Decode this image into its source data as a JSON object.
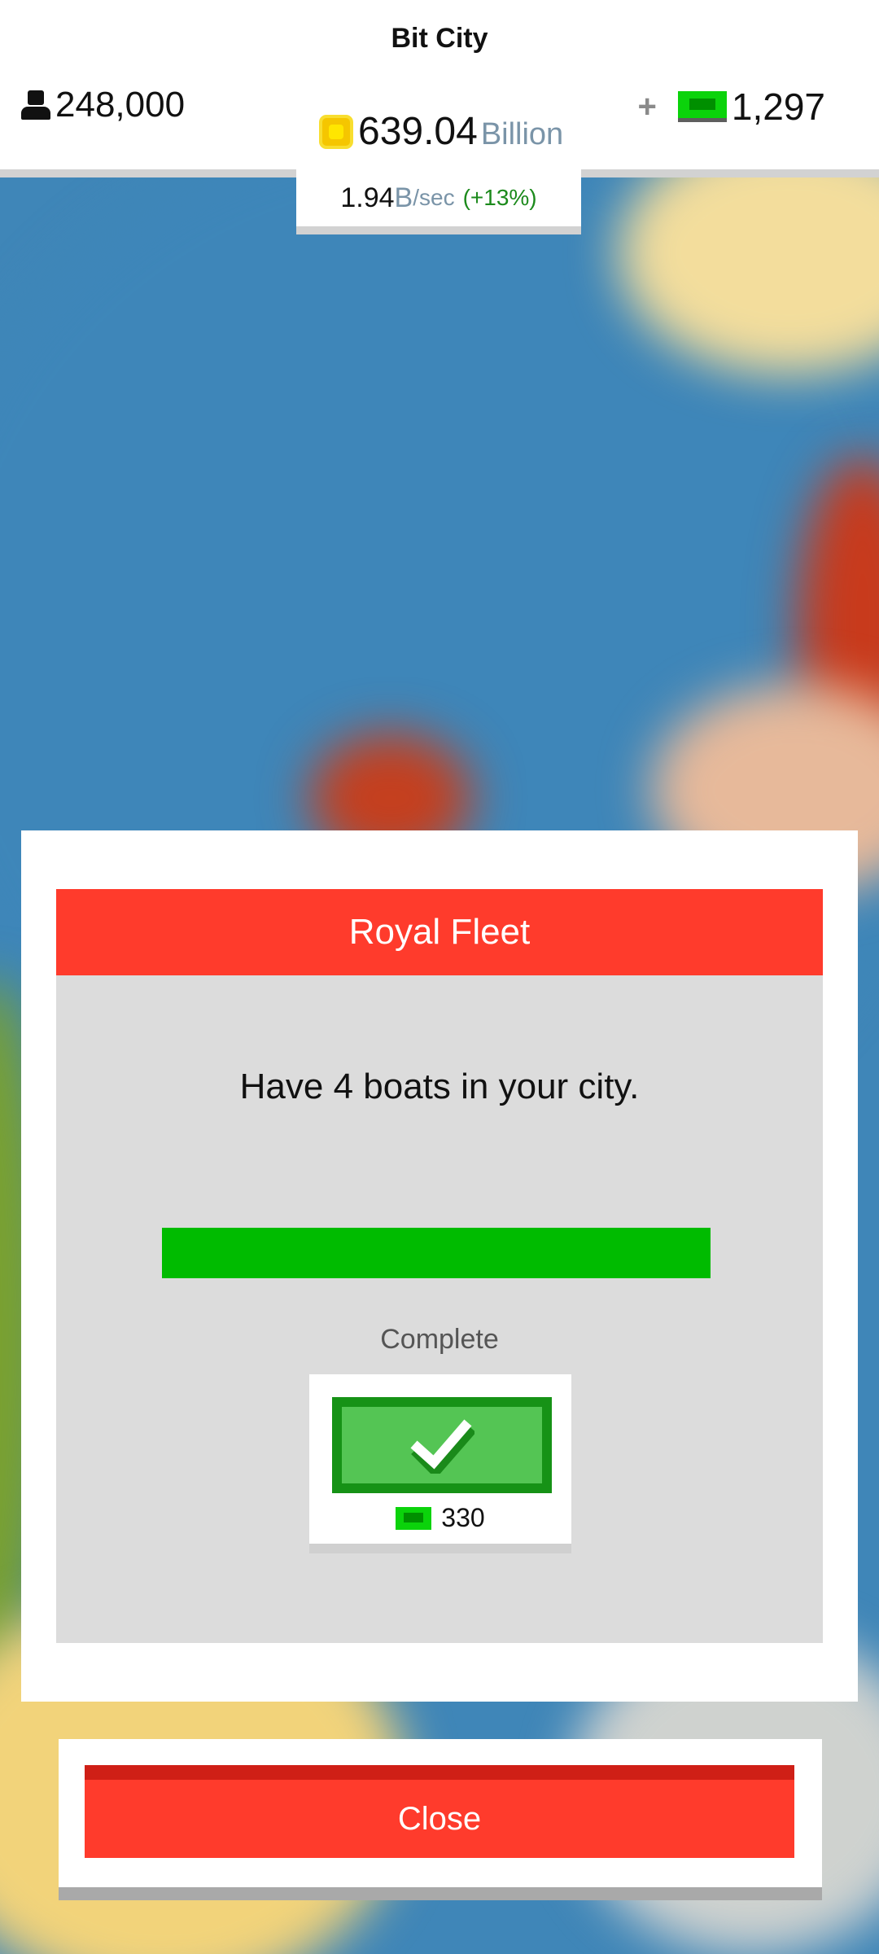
{
  "header": {
    "city_name": "Bit City",
    "population": "248,000",
    "coins_value": "639.04",
    "coins_unit": "Billion",
    "cash_plus": "+",
    "cash_value": "1,297",
    "rate_value": "1.94",
    "rate_unit": "B",
    "rate_per": "/sec",
    "rate_bonus": "(+13%)"
  },
  "dialog": {
    "title": "Royal Fleet",
    "description": "Have 4 boats in your city.",
    "progress_fraction": 1.0,
    "status": "Complete",
    "reward_value": "330",
    "claim_icon": "checkmark-icon"
  },
  "footer": {
    "close_label": "Close"
  },
  "colors": {
    "accent_red": "#ff3b2c",
    "progress_green": "#00bb00",
    "claim_green": "#54c554",
    "cash_green": "#0bd30b",
    "coin_yellow": "#f5c600"
  }
}
